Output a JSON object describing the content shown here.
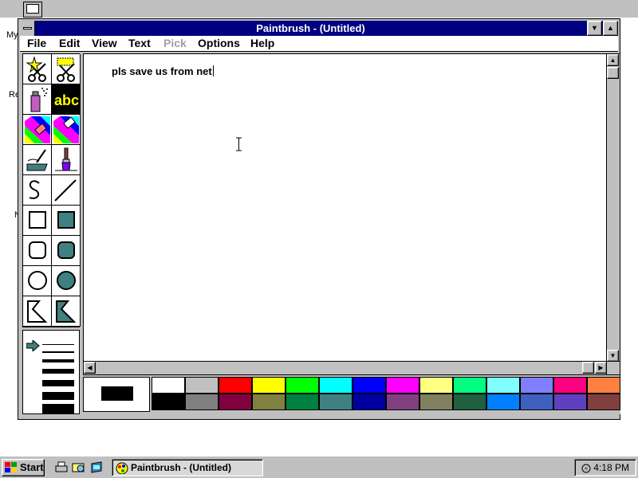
{
  "window": {
    "title": "Paintbrush - (Untitled)",
    "minimize_glyph": "▼",
    "maximize_glyph": "▲"
  },
  "desktop": {
    "label_my": "My",
    "label_re": "Re",
    "label_n": "N"
  },
  "menu": {
    "file": "File",
    "edit": "Edit",
    "view": "View",
    "text": "Text",
    "pick": "Pick",
    "options": "Options",
    "help": "Help"
  },
  "canvas": {
    "text": "pls save us from net"
  },
  "tools": [
    {
      "name": "scissors-tool",
      "selected": false
    },
    {
      "name": "pick-tool",
      "selected": false
    },
    {
      "name": "airbrush-tool",
      "selected": false
    },
    {
      "name": "text-tool",
      "label": "abc",
      "selected": true
    },
    {
      "name": "color-eraser-tool",
      "selected": false
    },
    {
      "name": "eraser-tool",
      "selected": false
    },
    {
      "name": "paint-roller-tool",
      "selected": false
    },
    {
      "name": "brush-tool",
      "selected": false
    },
    {
      "name": "curve-tool",
      "selected": false
    },
    {
      "name": "line-tool",
      "selected": false
    },
    {
      "name": "box-tool",
      "selected": false
    },
    {
      "name": "filled-box-tool",
      "selected": false
    },
    {
      "name": "rounded-box-tool",
      "selected": false
    },
    {
      "name": "filled-rounded-box-tool",
      "selected": false
    },
    {
      "name": "circle-tool",
      "selected": false
    },
    {
      "name": "filled-circle-tool",
      "selected": false
    },
    {
      "name": "polygon-tool",
      "selected": false
    },
    {
      "name": "filled-polygon-tool",
      "selected": false
    }
  ],
  "palette": {
    "foreground": "#000000",
    "background": "#ffffff",
    "top_row": [
      "#ffffff",
      "#c0c0c0",
      "#ff0000",
      "#ffff00",
      "#00ff00",
      "#00ffff",
      "#0000ff",
      "#ff00ff",
      "#ffff80",
      "#00ff80",
      "#80ffff",
      "#8080ff",
      "#ff0080",
      "#ff8040"
    ],
    "bottom_row": [
      "#000000",
      "#808080",
      "#800040",
      "#808040",
      "#008040",
      "#408080",
      "#0000a0",
      "#804080",
      "#808060",
      "#206040",
      "#0080ff",
      "#4060c0",
      "#6040c0",
      "#804040"
    ]
  },
  "taskbar": {
    "start_label": "Start",
    "task_label": "Paintbrush - (Untitled)",
    "clock": "4:18 PM"
  }
}
